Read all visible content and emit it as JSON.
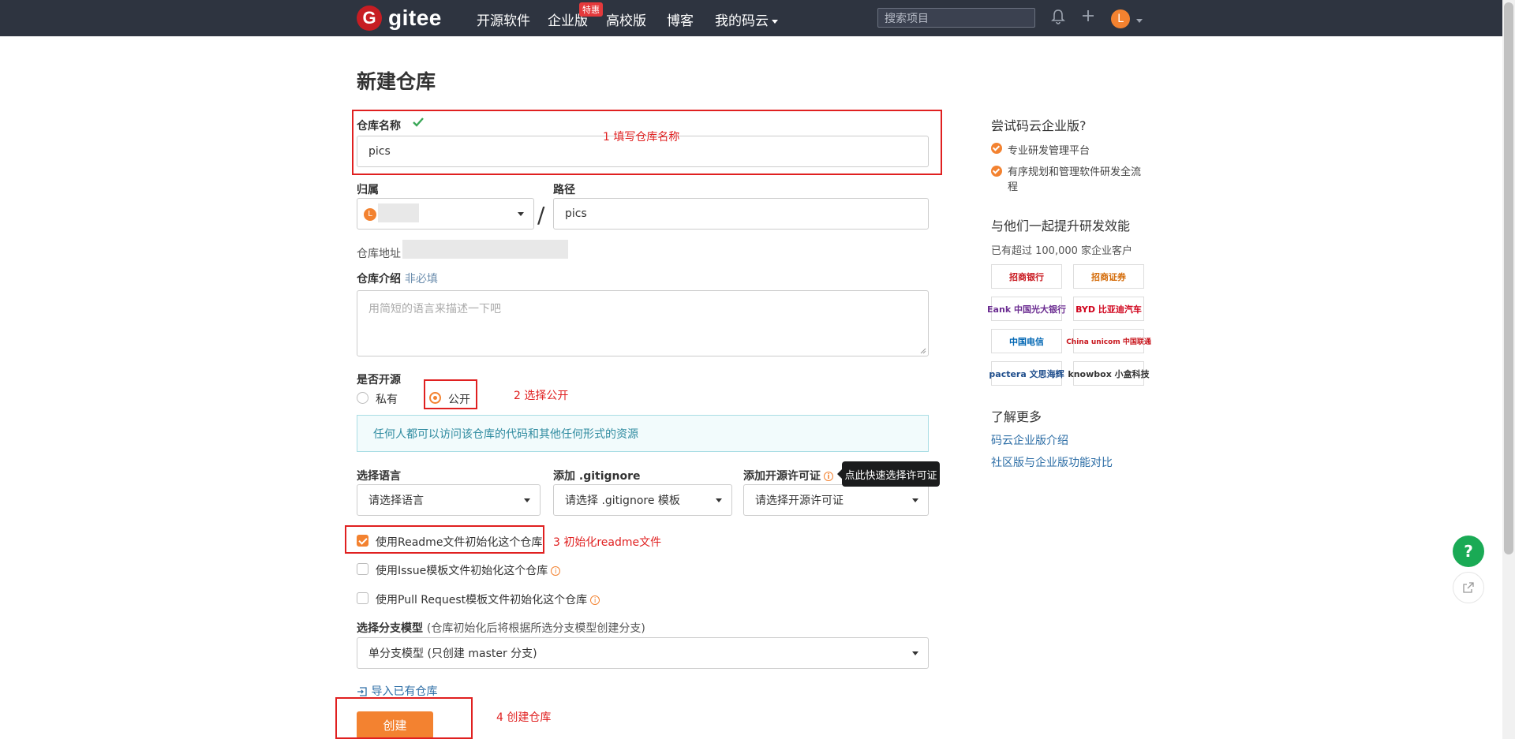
{
  "header": {
    "logo_text": "gitee",
    "logo_mark": "G",
    "nav": [
      "开源软件",
      "企业版",
      "高校版",
      "博客",
      "我的码云"
    ],
    "badge": "特惠",
    "search_placeholder": "搜索项目",
    "avatar_letter": "L"
  },
  "form": {
    "title": "新建仓库",
    "repo_name_label": "仓库名称",
    "repo_name_value": "pics",
    "owner_label": "归属",
    "owner_avatar": "L",
    "path_label": "路径",
    "path_value": "pics",
    "slash": "/",
    "repo_url_label": "仓库地址",
    "intro_label": "仓库介绍",
    "intro_optional": "非必填",
    "intro_placeholder": "用简短的语言来描述一下吧",
    "open_source_label": "是否开源",
    "private_label": "私有",
    "public_label": "公开",
    "visibility_selected": "公开",
    "public_notice": "任何人都可以访问该仓库的代码和其他任何形式的资源",
    "language_label": "选择语言",
    "language_value": "请选择语言",
    "gitignore_label": "添加 .gitignore",
    "gitignore_value": "请选择 .gitignore 模板",
    "license_label": "添加开源许可证",
    "license_value": "请选择开源许可证",
    "license_tooltip": "点此快速选择许可证",
    "readme_label": "使用Readme文件初始化这个仓库",
    "readme_checked": true,
    "issue_label": "使用Issue模板文件初始化这个仓库",
    "pr_label": "使用Pull Request模板文件初始化这个仓库",
    "branch_label": "选择分支模型",
    "branch_hint": "(仓库初始化后将根据所选分支模型创建分支)",
    "branch_value": "单分支模型 (只创建 master 分支)",
    "import_label": "导入已有仓库",
    "create_button": "创建"
  },
  "annotations": {
    "step1": "1 填写仓库名称",
    "step2": "2 选择公开",
    "step3": "3 初始化readme文件",
    "step4": "4 创建仓库"
  },
  "sidebar": {
    "try_title": "尝试码云企业版?",
    "features": [
      "专业研发管理平台",
      "有序规划和管理软件研发全流程"
    ],
    "join_title": "与他们一起提升研发效能",
    "customers_text": "已有超过 100,000 家企业客户",
    "logos": [
      "招商银行",
      "招商证券",
      "Eank 中国光大银行",
      "BYD 比亚迪汽车",
      "中国电信",
      "China unicom 中国联通",
      "pactera 文思海辉",
      "knowbox 小盒科技"
    ],
    "learn_title": "了解更多",
    "links": [
      "码云企业版介绍",
      "社区版与企业版功能对比"
    ]
  },
  "float": {
    "help": "?"
  },
  "colors": {
    "brand_orange": "#f38230",
    "gitee_red": "#c71d23",
    "annotation_red": "#e02020",
    "header_bg": "#2e3440"
  },
  "icons": [
    "check-icon",
    "bell-icon",
    "plus-icon",
    "info-icon",
    "import-icon",
    "share-icon",
    "question-icon"
  ]
}
